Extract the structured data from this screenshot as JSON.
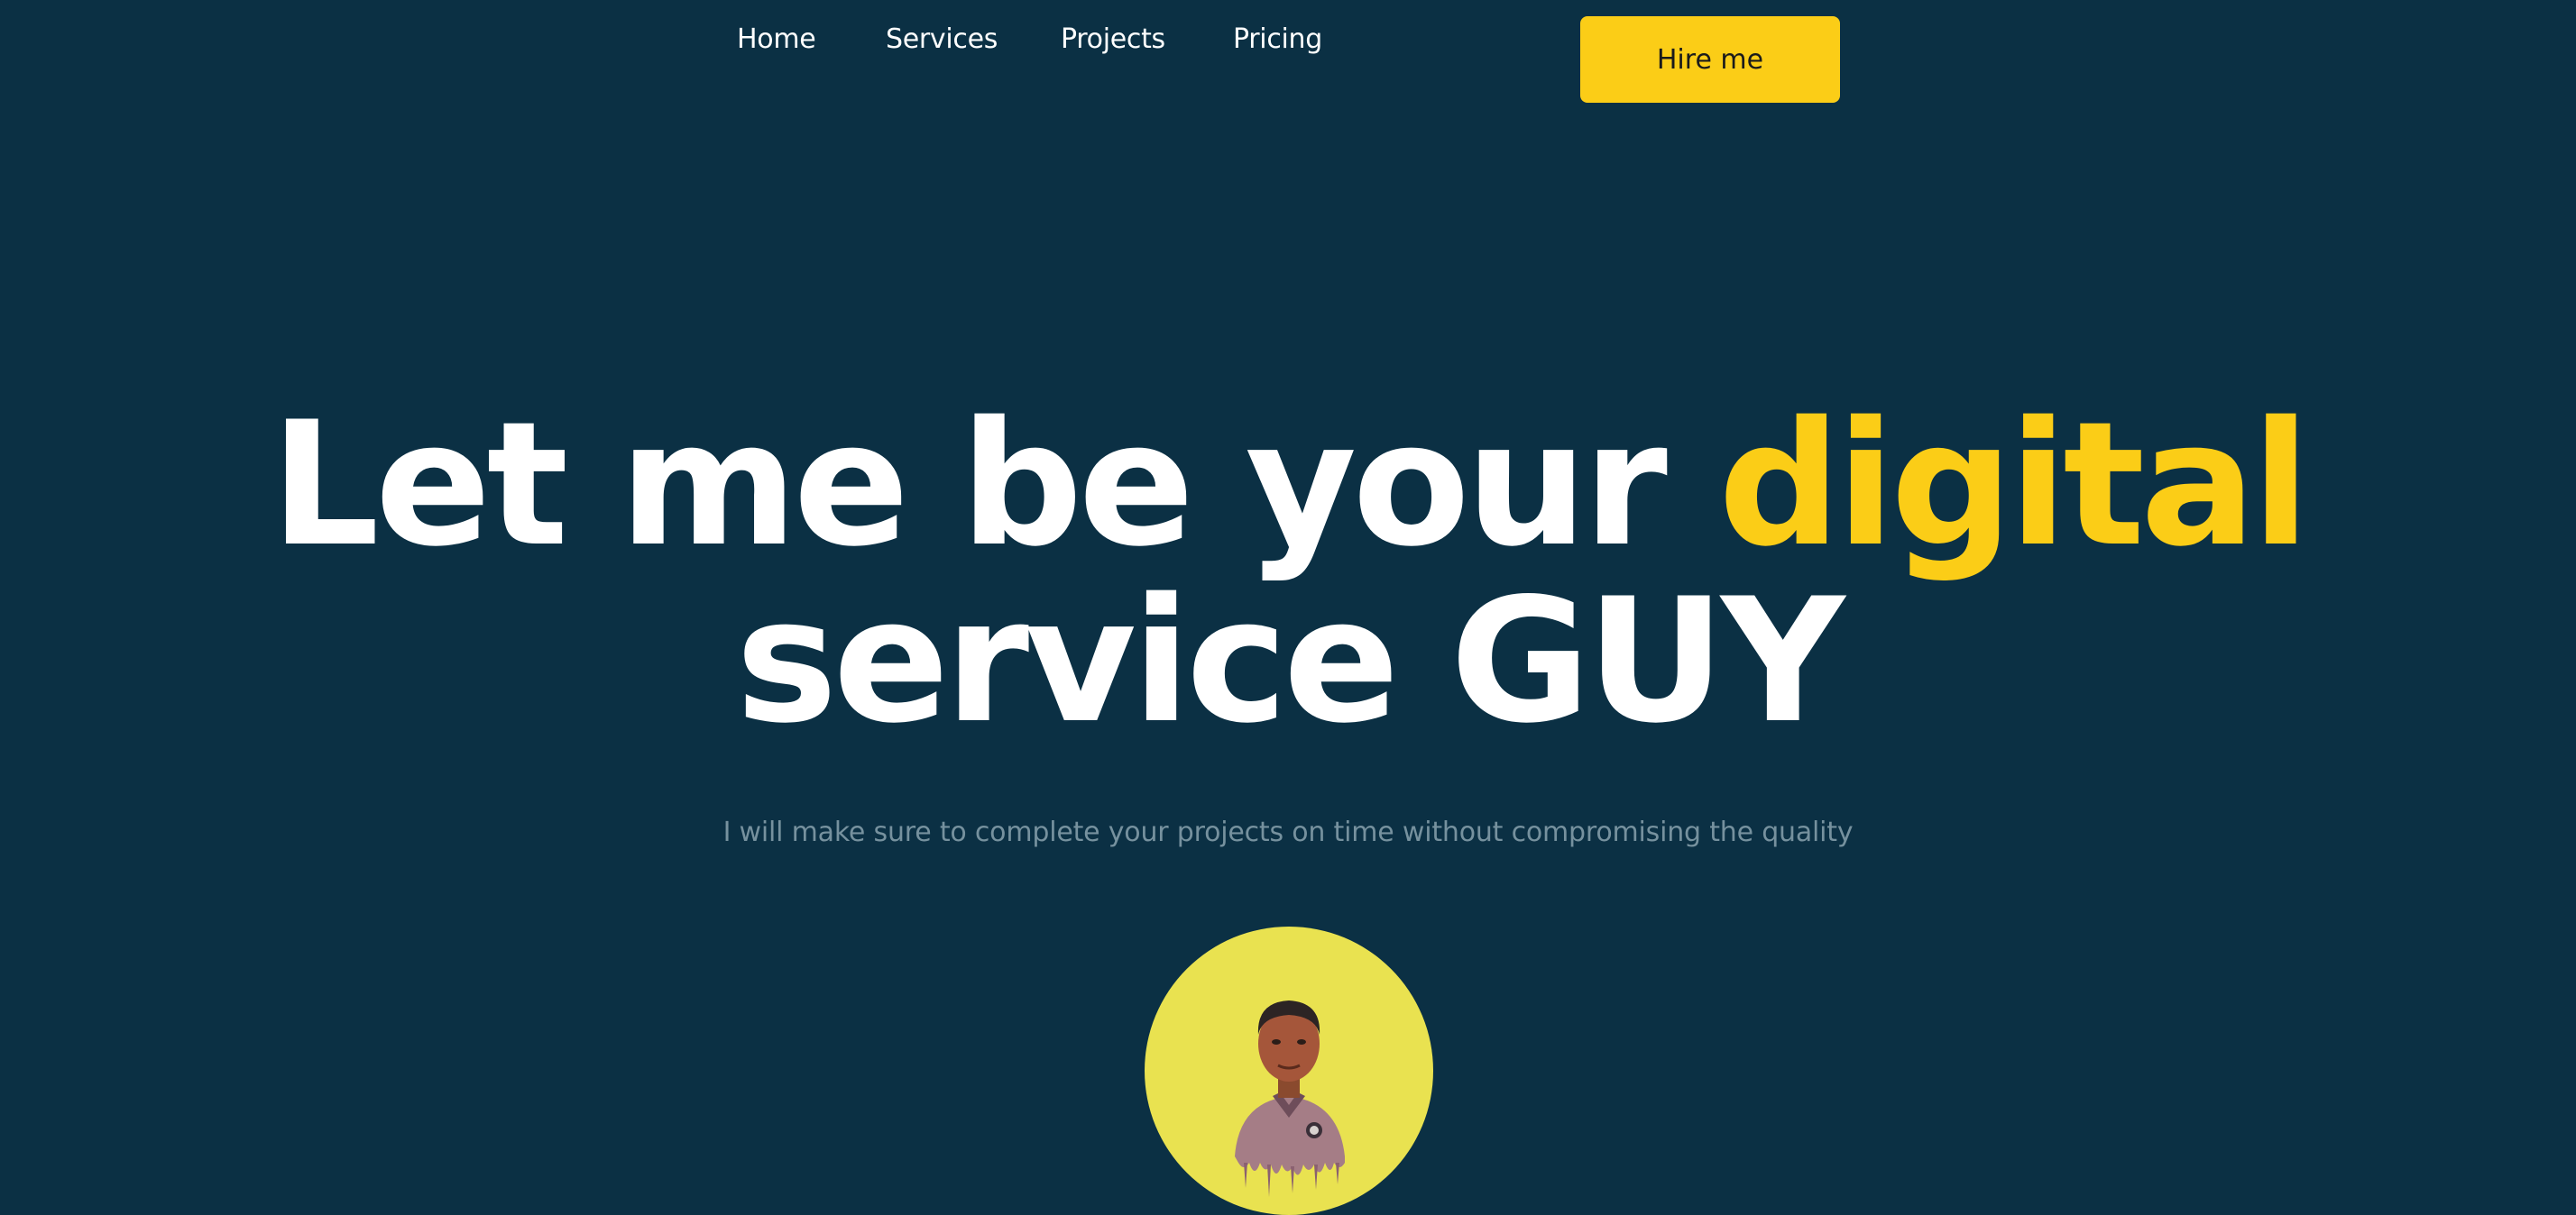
{
  "nav": {
    "items": [
      {
        "label": "Home"
      },
      {
        "label": "Services"
      },
      {
        "label": "Projects"
      },
      {
        "label": "Pricing"
      }
    ],
    "cta_label": "Hire me"
  },
  "hero": {
    "title_part1": "Let me be your ",
    "title_highlight": "digital",
    "title_part2": "service GUY",
    "subtitle": "I will make sure to complete your projects on time without compromising the quality"
  },
  "colors": {
    "background": "#0b3044",
    "accent": "#fbcd17",
    "avatar_bg": "#e9e250",
    "subtitle": "#76919e"
  }
}
